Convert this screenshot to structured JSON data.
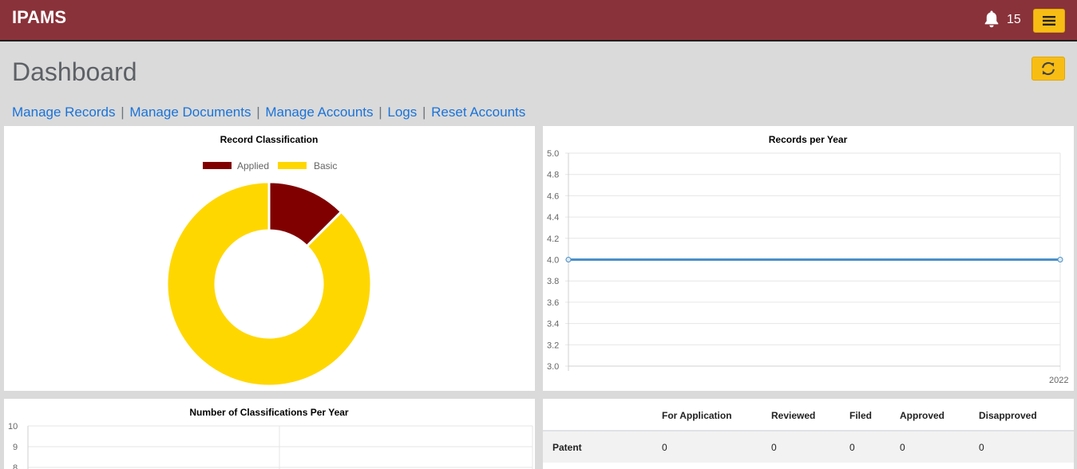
{
  "header": {
    "brand": "IPAMS",
    "notification_count": "15",
    "icons": {
      "bell": "bell-icon",
      "menu": "hamburger-menu-icon"
    },
    "colors": {
      "bar": "#8a323a",
      "accent": "#f8bd14"
    }
  },
  "page": {
    "title": "Dashboard",
    "refresh_icon": "refresh-icon"
  },
  "nav_links": [
    {
      "label": "Manage Records"
    },
    {
      "label": "Manage Documents"
    },
    {
      "label": "Manage Accounts"
    },
    {
      "label": "Logs"
    },
    {
      "label": "Reset Accounts"
    }
  ],
  "chart_data": [
    {
      "type": "pie",
      "variant": "doughnut",
      "title": "Record Classification",
      "categories": [
        "Applied",
        "Basic"
      ],
      "values": [
        1,
        7
      ],
      "colors": [
        "#800000",
        "#ffd700"
      ],
      "legend": "top"
    },
    {
      "type": "line",
      "title": "Records per Year",
      "x": [
        "2022"
      ],
      "series": [
        {
          "values": [
            4
          ],
          "color": "#4a90c8"
        }
      ],
      "ylim": [
        3.0,
        5.0
      ],
      "yticks": [
        "5.0",
        "4.8",
        "4.6",
        "4.4",
        "4.2",
        "4.0",
        "3.8",
        "3.6",
        "3.4",
        "3.2",
        "3.0"
      ],
      "grid": true
    },
    {
      "type": "bar",
      "title": "Number of Classifications Per Year",
      "yticks_visible": [
        "10",
        "9",
        "8"
      ],
      "grid": true
    }
  ],
  "status_table": {
    "columns": [
      "",
      "For Application",
      "Reviewed",
      "Filed",
      "Approved",
      "Disapproved"
    ],
    "rows": [
      {
        "label": "Patent",
        "values": [
          "0",
          "0",
          "0",
          "0",
          "0"
        ]
      }
    ]
  }
}
